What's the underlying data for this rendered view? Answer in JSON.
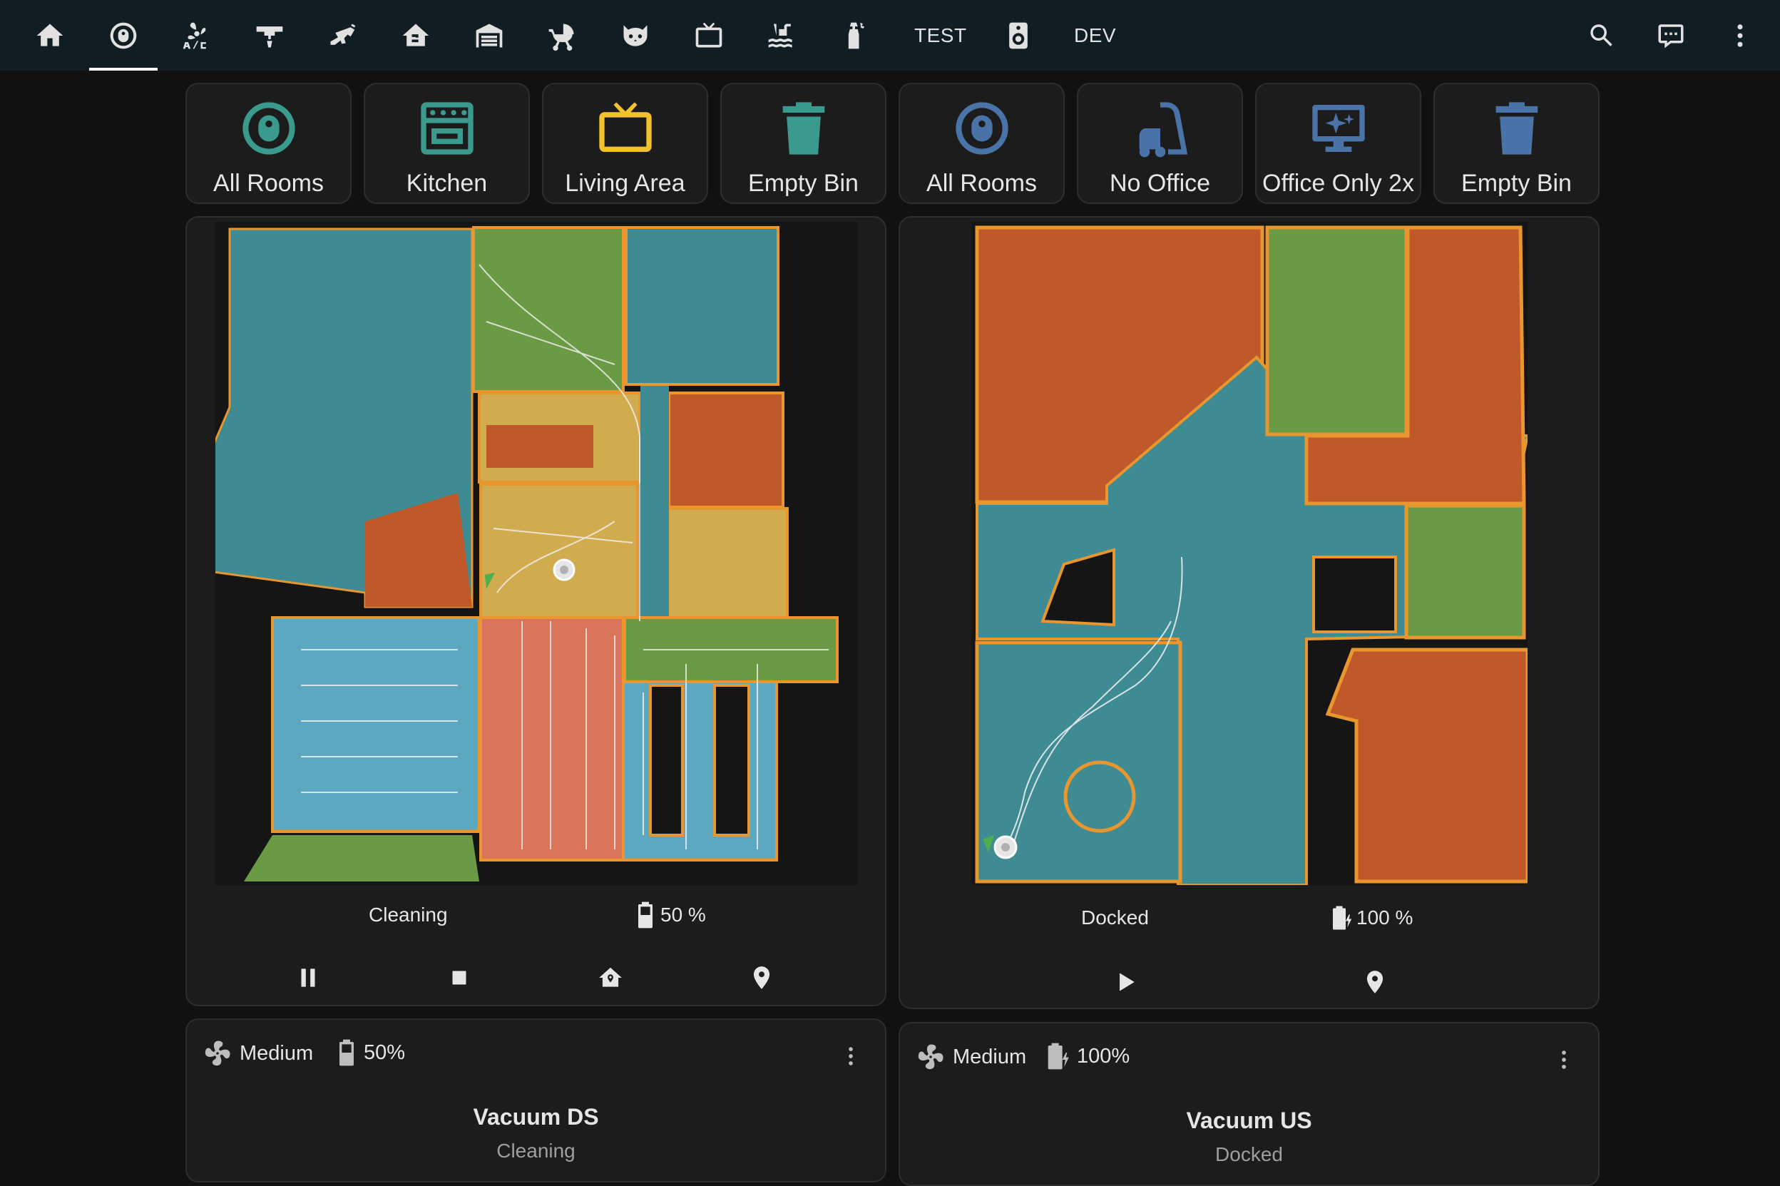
{
  "topbar": {
    "tabs": [
      {
        "icon": "home-icon"
      },
      {
        "icon": "robot-vacuum-icon",
        "active": true
      },
      {
        "icon": "air-conditioner-icon"
      },
      {
        "icon": "ceiling-lamp-icon"
      },
      {
        "icon": "cctv-camera-icon"
      },
      {
        "icon": "home-floor-icon"
      },
      {
        "icon": "garage-icon"
      },
      {
        "icon": "baby-stroller-icon"
      },
      {
        "icon": "cat-icon"
      },
      {
        "icon": "television-icon"
      },
      {
        "icon": "pool-icon"
      },
      {
        "icon": "spray-bottle-icon"
      },
      {
        "label": "TEST"
      },
      {
        "icon": "speaker-icon"
      },
      {
        "label": "DEV"
      }
    ],
    "actions": [
      "search-icon",
      "chat-icon",
      "more-vertical-icon"
    ]
  },
  "buttons": [
    {
      "label": "All Rooms",
      "icon": "robot-vacuum-icon",
      "color": "#3a9a8e"
    },
    {
      "label": "Kitchen",
      "icon": "stove-icon",
      "color": "#3a9a8e"
    },
    {
      "label": "Living Area",
      "icon": "television-icon",
      "color": "#f2c12e"
    },
    {
      "label": "Empty Bin",
      "icon": "trash-can-icon",
      "color": "#3a9a8e"
    },
    {
      "label": "All Rooms",
      "icon": "robot-vacuum-icon",
      "color": "#4a73a8"
    },
    {
      "label": "No Office",
      "icon": "vacuum-cleaner-icon",
      "color": "#4a73a8"
    },
    {
      "label": "Office Only 2x",
      "icon": "monitor-sparkle-icon",
      "color": "#4a73a8"
    },
    {
      "label": "Empty Bin",
      "icon": "trash-can-icon",
      "color": "#4a73a8"
    }
  ],
  "vacuum_ds": {
    "status": "Cleaning",
    "battery": "50 %",
    "fan": "Medium",
    "battery_short": "50%",
    "name": "Vacuum DS",
    "state": "Cleaning"
  },
  "vacuum_us": {
    "status": "Docked",
    "battery": "100 %",
    "fan": "Medium",
    "battery_short": "100%",
    "name": "Vacuum US",
    "state": "Docked"
  },
  "map_colors": {
    "teal": "#3e8b93",
    "orange": "#c0582a",
    "green": "#6b9a45",
    "yellow": "#d1ac4e",
    "border": "#e8962d",
    "blue": "#5ba8c0",
    "salmon": "#d9735a"
  }
}
